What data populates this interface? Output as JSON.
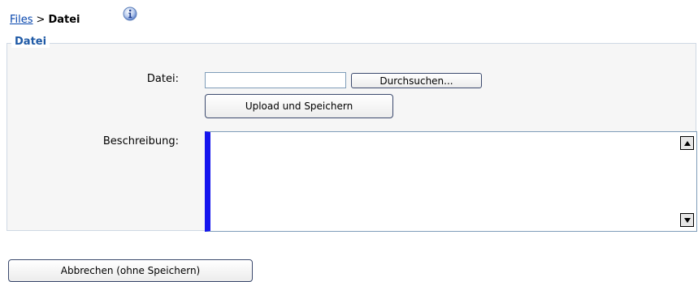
{
  "breadcrumb": {
    "link_label": "Files",
    "separator": ">",
    "current": "Datei"
  },
  "icons": {
    "info": "info-icon"
  },
  "fieldset": {
    "legend": "Datei",
    "file_label": "Datei:",
    "file_value": "",
    "browse_label": "Durchsuchen...",
    "upload_label": "Upload und Speichern",
    "description_label": "Beschreibung:",
    "description_value": ""
  },
  "footer": {
    "cancel_label": "Abbrechen (ohne Speichern)"
  },
  "colors": {
    "link": "#0645ad",
    "legend": "#1f5aa6",
    "fieldset_border": "#cfd8e4",
    "fieldset_bg": "#f6f6f6",
    "textarea_focus_bar": "#1515ee"
  }
}
